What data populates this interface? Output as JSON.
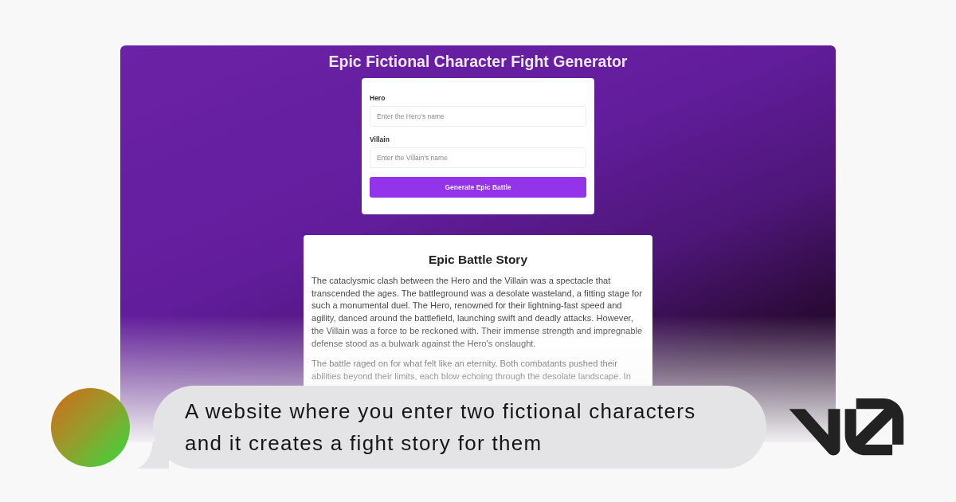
{
  "app": {
    "title": "Epic Fictional Character Fight Generator",
    "form": {
      "fields": [
        {
          "label": "Hero",
          "placeholder": "Enter the Hero's name"
        },
        {
          "label": "Villain",
          "placeholder": "Enter the Villain's name"
        }
      ],
      "button": "Generate Epic Battle"
    },
    "story": {
      "title": "Epic Battle Story",
      "paragraphs": [
        "The cataclysmic clash between the Hero and the Villain was a spectacle that transcended the ages. The battleground was a desolate wasteland, a fitting stage for such a monumental duel. The Hero, renowned for their lightning-fast speed and agility, danced around the battlefield, launching swift and deadly attacks. However, the Villain was a force to be reckoned with. Their immense strength and impregnable defense stood as a bulwark against the Hero's onslaught.",
        "The battle raged on for what felt like an eternity. Both combatants pushed their abilities beyond their limits, each blow echoing through the desolate landscape. In"
      ]
    }
  },
  "caption": {
    "text": "A website where you enter two fictional characters and it creates a fight story for them"
  }
}
